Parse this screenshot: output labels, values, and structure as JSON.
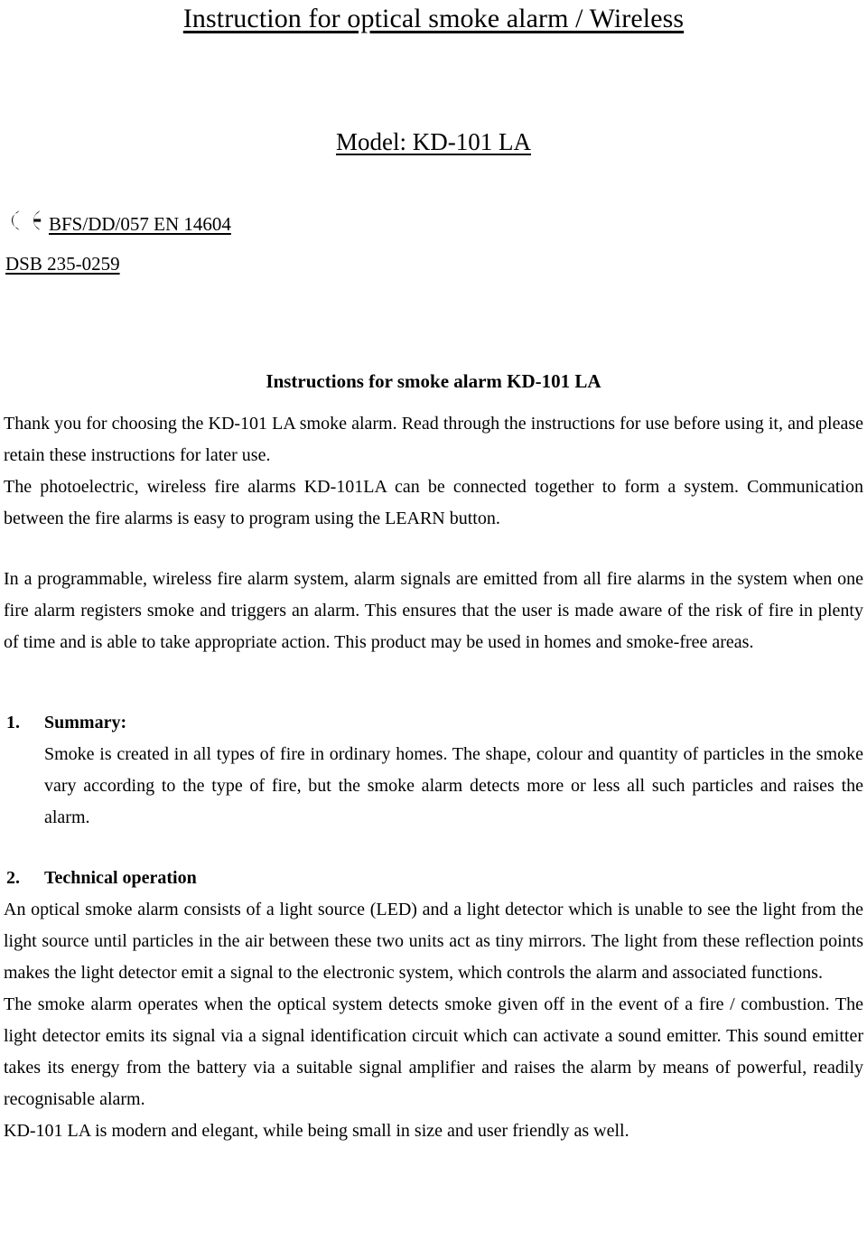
{
  "document": {
    "title": "Instruction for optical smoke alarm / Wireless",
    "model_line": "Model: KD-101 LA",
    "certification": {
      "ce_icon": "ce-mark-icon",
      "standard": "BFS/DD/057 EN 14604",
      "approval": "DSB 235-0259"
    },
    "section_heading": "Instructions for smoke alarm KD-101 LA",
    "intro": {
      "para1": "Thank you for choosing the KD-101 LA smoke alarm. Read through the instructions for use before using it, and please retain these instructions for later use.",
      "para2": "The photoelectric, wireless fire alarms KD-101LA can be connected together to form a system. Communication between the fire alarms is easy to program using the LEARN button.",
      "para3": "In a programmable, wireless fire alarm system, alarm signals are emitted from all fire alarms in the system when one fire alarm registers smoke and triggers an alarm. This ensures that the user is made aware of the risk of fire in plenty of time and is able to take appropriate action. This product may be used in homes and smoke-free areas."
    },
    "sections": [
      {
        "number": "1.",
        "title": "Summary:",
        "body": "Smoke is created in all types of fire in ordinary homes. The shape, colour and quantity of particles in the smoke vary according to the type of fire, but the smoke alarm detects more or less all such particles and raises the alarm."
      },
      {
        "number": "2.",
        "title": "Technical operation",
        "paragraphs": {
          "p1": "An optical smoke alarm consists of a light source (LED) and a light detector which is unable to see the light from the light source until particles in the air between these two units act as tiny mirrors. The light from these reflection points makes the light detector emit a signal to the electronic system, which controls the alarm and associated functions.",
          "p2": "The smoke alarm operates when the optical system detects smoke given off in the event of a fire / combustion. The light detector emits its signal via a signal identification circuit which can activate a sound emitter. This sound emitter takes its energy from the battery via a suitable signal amplifier and raises the alarm by means of powerful, readily recognisable alarm.",
          "p3": "KD-101 LA is modern and elegant, while being small in size and user friendly as well."
        }
      }
    ]
  },
  "colors": {
    "text": "#000000",
    "background": "#ffffff"
  }
}
